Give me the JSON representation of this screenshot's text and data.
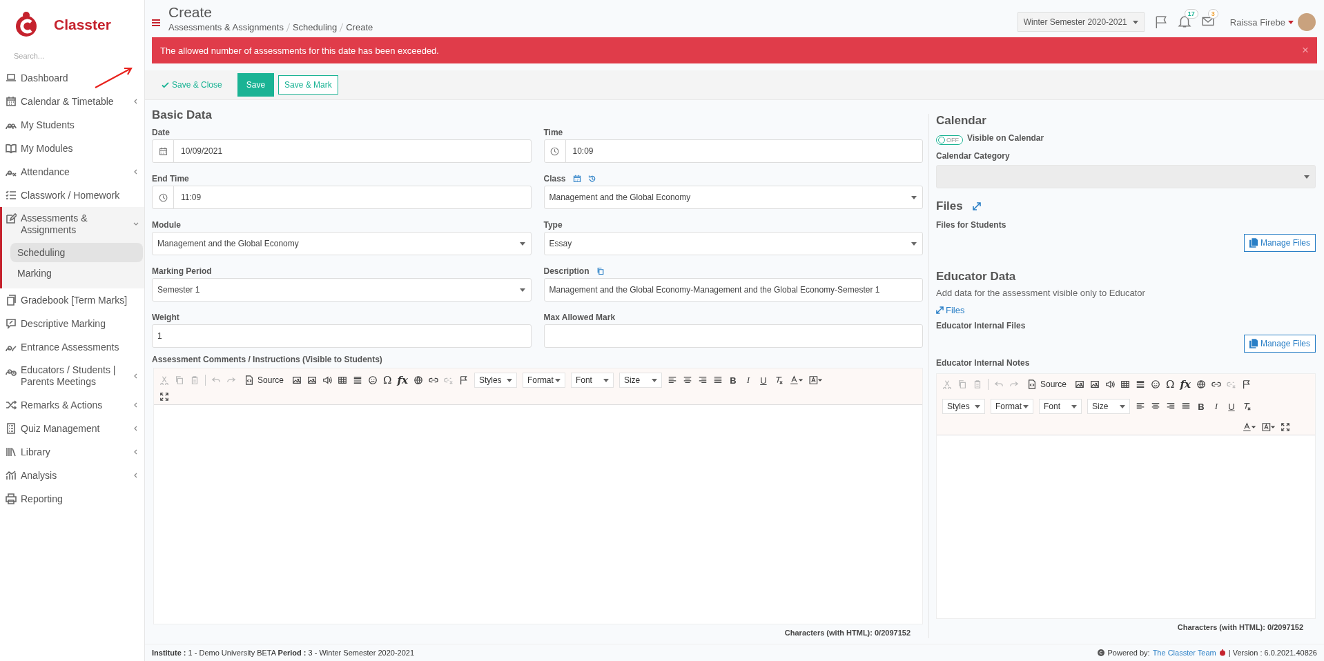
{
  "sidebar": {
    "brand": "Classter",
    "search_placeholder": "Search...",
    "items": [
      {
        "label": "Dashboard",
        "submenu": false,
        "expanded": false
      },
      {
        "label": "Calendar & Timetable",
        "submenu": true,
        "expanded": false
      },
      {
        "label": "My Students",
        "submenu": false,
        "expanded": false
      },
      {
        "label": "My Modules",
        "submenu": false,
        "expanded": false
      },
      {
        "label": "Attendance",
        "submenu": true,
        "expanded": false
      },
      {
        "label": "Classwork / Homework",
        "submenu": false,
        "expanded": false
      },
      {
        "label": "Assessments & Assignments",
        "submenu": true,
        "expanded": true,
        "children": [
          {
            "label": "Scheduling",
            "selected": true
          },
          {
            "label": "Marking",
            "selected": false
          }
        ]
      },
      {
        "label": "Gradebook [Term Marks]",
        "submenu": false,
        "expanded": false
      },
      {
        "label": "Descriptive Marking",
        "submenu": false,
        "expanded": false
      },
      {
        "label": "Entrance Assessments",
        "submenu": false,
        "expanded": false
      },
      {
        "label": "Educators / Students | Parents Meetings",
        "submenu": true,
        "expanded": false
      },
      {
        "label": "Remarks & Actions",
        "submenu": true,
        "expanded": false
      },
      {
        "label": "Quiz Management",
        "submenu": true,
        "expanded": false
      },
      {
        "label": "Library",
        "submenu": true,
        "expanded": false
      },
      {
        "label": "Analysis",
        "submenu": true,
        "expanded": false
      },
      {
        "label": "Reporting",
        "submenu": false,
        "expanded": false
      }
    ]
  },
  "header": {
    "title": "Create",
    "breadcrumb": [
      "Assessments & Assignments",
      "Scheduling",
      "Create"
    ],
    "semester": "Winter Semester 2020-2021",
    "notifications": "17",
    "messages": "3",
    "user": "Raissa Firebe"
  },
  "alert": {
    "message": "The allowed number of assessments for this date has been exceeded.",
    "close": "×"
  },
  "actions": {
    "save_close": "Save & Close",
    "save": "Save",
    "save_mark": "Save & Mark"
  },
  "basic_data": {
    "title": "Basic Data",
    "fields": [
      {
        "label": "Date",
        "kind": "date",
        "value": "10/09/2021"
      },
      {
        "label": "Time",
        "kind": "time",
        "value": "10:09"
      },
      {
        "label": "End Time",
        "kind": "time",
        "value": "11:09"
      },
      {
        "label": "Class",
        "kind": "select",
        "value": "Management and the Global Economy"
      },
      {
        "label": "Module",
        "kind": "select",
        "value": "Management and the Global Economy"
      },
      {
        "label": "Type",
        "kind": "select",
        "value": "Essay"
      },
      {
        "label": "Marking Period",
        "kind": "select",
        "value": "Semester 1"
      },
      {
        "label": "Description",
        "kind": "text",
        "value": "Management and the Global Economy-Management and the Global Economy-Semester 1"
      },
      {
        "label": "Weight",
        "kind": "text",
        "value": "1"
      },
      {
        "label": "Max Allowed Mark",
        "kind": "text"
      }
    ],
    "comments_label": "Assessment Comments / Instructions (Visible to Students)",
    "toolbar": {
      "clipboard_enabled": false,
      "undo_enabled": false,
      "source": "Source",
      "symbols": [
        "Ω",
        "fx"
      ],
      "dropdowns": [
        "Styles",
        "Format",
        "Font",
        "Size"
      ],
      "marks": [
        "B",
        "I",
        "U"
      ]
    },
    "counter": "Characters (with HTML): 0/2097152"
  },
  "calendar": {
    "title": "Calendar",
    "toggle": {
      "on": false,
      "label": "OFF"
    },
    "visible_label": "Visible on Calendar",
    "category_label": "Calendar Category"
  },
  "files": {
    "title": "Files",
    "students_label": "Files for Students",
    "manage": "Manage Files"
  },
  "educator": {
    "title": "Educator Data",
    "description": "Add data for the assessment visible only to Educator",
    "files_link": "Files",
    "internal_files_label": "Educator Internal Files",
    "manage": "Manage Files",
    "notes_label": "Educator Internal Notes",
    "toolbar": {
      "clipboard_enabled": false,
      "undo_enabled": false,
      "source": "Source",
      "symbols": [
        "Ω",
        "fx"
      ],
      "dropdowns": [
        "Styles",
        "Format",
        "Font",
        "Size"
      ],
      "marks": [
        "B",
        "I",
        "U"
      ]
    },
    "counter": "Characters (with HTML): 0/2097152"
  },
  "footer": {
    "info": "**Institute :** 1 - Demo University BETA **Period :** 3 - Winter Semester 2020-2021",
    "powered": "Powered by:",
    "team": "The Classter Team",
    "version": "| Version : 6.0.2021.40826"
  }
}
